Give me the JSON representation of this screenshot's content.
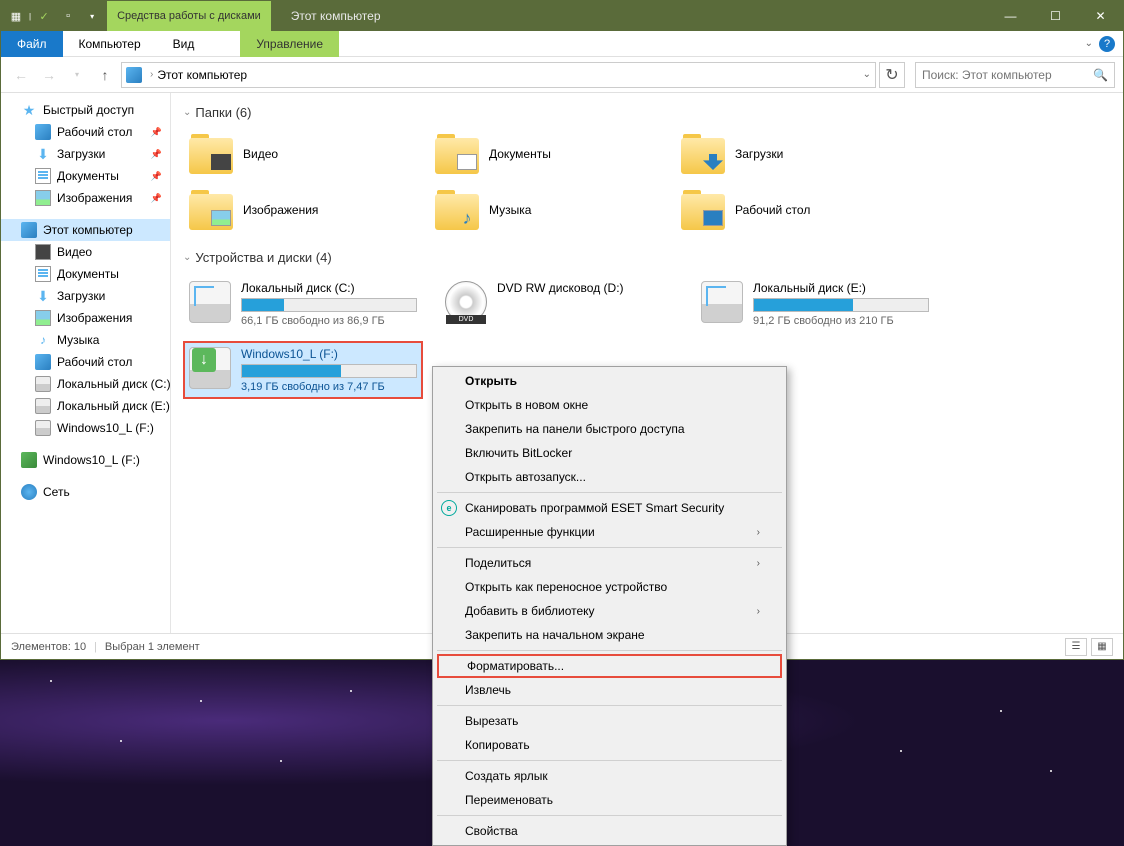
{
  "titlebar": {
    "ribbon_context": "Средства работы с дисками",
    "title": "Этот компьютер"
  },
  "ribbon": {
    "file": "Файл",
    "computer": "Компьютер",
    "view": "Вид",
    "manage": "Управление"
  },
  "addressbar": {
    "location": "Этот компьютер"
  },
  "search": {
    "placeholder": "Поиск: Этот компьютер"
  },
  "sidebar": {
    "quick_access": "Быстрый доступ",
    "desktop": "Рабочий стол",
    "downloads": "Загрузки",
    "documents": "Документы",
    "pictures": "Изображения",
    "this_pc": "Этот компьютер",
    "videos": "Видео",
    "documents2": "Документы",
    "downloads2": "Загрузки",
    "pictures2": "Изображения",
    "music": "Музыка",
    "desktop2": "Рабочий стол",
    "local_c": "Локальный диск (C:)",
    "local_e": "Локальный диск (E:)",
    "win10_f": "Windows10_L (F:)",
    "win10_f2": "Windows10_L (F:)",
    "network": "Сеть"
  },
  "groups": {
    "folders": "Папки (6)",
    "devices": "Устройства и диски (4)"
  },
  "folders": {
    "videos": "Видео",
    "documents": "Документы",
    "downloads": "Загрузки",
    "pictures": "Изображения",
    "music": "Музыка",
    "desktop": "Рабочий стол"
  },
  "drives": {
    "c": {
      "name": "Локальный диск (C:)",
      "free": "66,1 ГБ свободно из 86,9 ГБ",
      "fill": 24
    },
    "dvd": {
      "name": "DVD RW дисковод (D:)"
    },
    "e": {
      "name": "Локальный диск (E:)",
      "free": "91,2 ГБ свободно из 210 ГБ",
      "fill": 57
    },
    "f": {
      "name": "Windows10_L (F:)",
      "free": "3,19 ГБ свободно из 7,47 ГБ",
      "fill": 57
    }
  },
  "statusbar": {
    "items": "Элементов: 10",
    "selected": "Выбран 1 элемент"
  },
  "context_menu": {
    "open": "Открыть",
    "open_new": "Открыть в новом окне",
    "pin_quick": "Закрепить на панели быстрого доступа",
    "bitlocker": "Включить BitLocker",
    "autoplay": "Открыть автозапуск...",
    "eset": "Сканировать программой ESET Smart Security",
    "advanced": "Расширенные функции",
    "share": "Поделиться",
    "portable": "Открыть как переносное устройство",
    "library": "Добавить в библиотеку",
    "pin_start": "Закрепить на начальном экране",
    "format": "Форматировать...",
    "eject": "Извлечь",
    "cut": "Вырезать",
    "copy": "Копировать",
    "shortcut": "Создать ярлык",
    "rename": "Переименовать",
    "properties": "Свойства"
  }
}
